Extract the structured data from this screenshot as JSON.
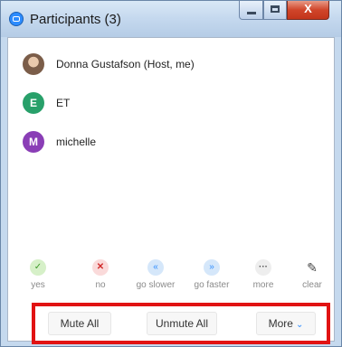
{
  "window": {
    "title": "Participants (3)",
    "close_label": "X"
  },
  "participants": [
    {
      "name": "Donna Gustafson (Host, me)",
      "avatar": "photo"
    },
    {
      "name": "ET",
      "avatar_letter": "E",
      "avatar_color": "#28a06a"
    },
    {
      "name": "michelle",
      "avatar_letter": "M",
      "avatar_color": "#8a3eb6"
    }
  ],
  "reactions": [
    {
      "label": "yes",
      "icon": "check-icon",
      "glyph": "✓"
    },
    {
      "label": "no",
      "icon": "x-icon",
      "glyph": "✕"
    },
    {
      "label": "go slower",
      "icon": "rewind-icon",
      "glyph": "«"
    },
    {
      "label": "go faster",
      "icon": "fast-forward-icon",
      "glyph": "»"
    },
    {
      "label": "more",
      "icon": "ellipsis-icon",
      "glyph": "···"
    },
    {
      "label": "clear",
      "icon": "eraser-icon",
      "glyph": "✎"
    }
  ],
  "buttons": {
    "mute_all": "Mute All",
    "unmute_all": "Unmute All",
    "more": "More",
    "more_caret": "⌄"
  },
  "colors": {
    "accent": "#2d8cff",
    "highlight_border": "#e11313"
  }
}
